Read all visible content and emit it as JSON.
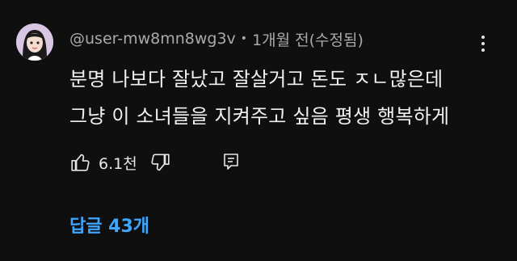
{
  "comment": {
    "author": "@user-mw8mn8wg3v",
    "separator": "•",
    "time": "1개월 전",
    "edited": "(수정됨)",
    "text_lines": [
      "분명 나보다 잘났고 잘살거고 돈도 ㅈㄴ많은데",
      "그냥 이 소녀들을 지켜주고 싶음 평생 행복하게"
    ],
    "like_count": "6.1천",
    "replies_label": "답글 43개"
  },
  "icons": {
    "avatar": "avatar-girl",
    "more": "more-vert-icon",
    "like": "thumb-up-icon",
    "dislike": "thumb-down-icon",
    "reply": "comment-icon"
  },
  "colors": {
    "background": "#0f0f0f",
    "text": "#f1f1f1",
    "meta": "#aaaaaa",
    "link": "#3ea6ff"
  }
}
